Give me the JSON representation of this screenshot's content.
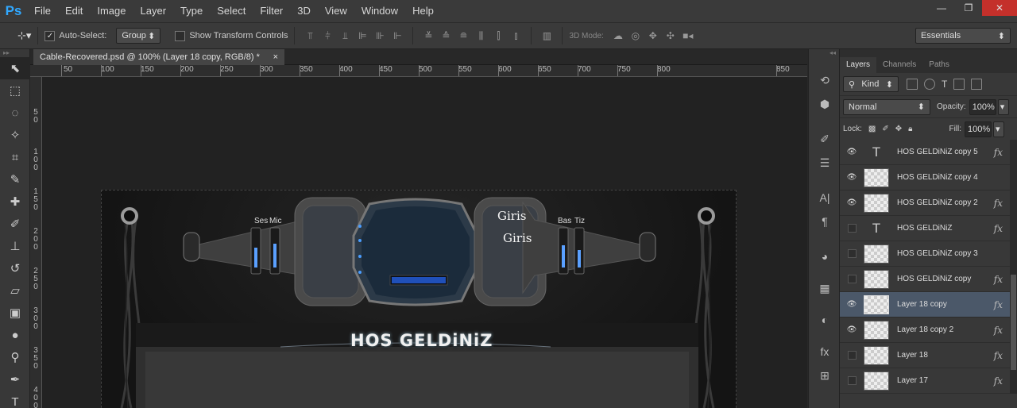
{
  "app": {
    "logo": "Ps"
  },
  "menu": [
    "File",
    "Edit",
    "Image",
    "Layer",
    "Type",
    "Select",
    "Filter",
    "3D",
    "View",
    "Window",
    "Help"
  ],
  "window_controls": {
    "minimize": "—",
    "restore": "❐",
    "close": "✕"
  },
  "options": {
    "auto_select_label": "Auto-Select:",
    "auto_select_value": "Group",
    "transform_label": "Show Transform Controls",
    "mode_3d_label": "3D Mode:",
    "workspace": "Essentials"
  },
  "document": {
    "tab_title": "Cable-Recovered.psd @ 100% (Layer 18 copy, RGB/8) *",
    "close": "×"
  },
  "ruler_top": [
    "50",
    "100",
    "150",
    "200",
    "250",
    "300",
    "350",
    "400",
    "450",
    "500",
    "550",
    "600",
    "650",
    "700",
    "750",
    "800",
    "850"
  ],
  "ruler_left": [
    "5 0",
    "1 0 0",
    "1 5 0",
    "2 0 0",
    "2 5 0",
    "3 0 0",
    "3 5 0",
    "4 0 0"
  ],
  "artwork": {
    "ses": "Ses",
    "mic": "Mic",
    "bas": "Bas",
    "tiz": "Tiz",
    "giris1": "Giris",
    "giris2": "Giris",
    "banner": "HOS GELDiNiZ"
  },
  "panel": {
    "tabs": [
      "Layers",
      "Channels",
      "Paths"
    ],
    "kind": "Kind",
    "blend": "Normal",
    "opacity_label": "Opacity:",
    "opacity": "100%",
    "lock_label": "Lock:",
    "fill_label": "Fill:",
    "fill": "100%"
  },
  "layers": [
    {
      "name": "HOS GELDiNiZ copy 5",
      "visible": true,
      "type": "text",
      "fx": true
    },
    {
      "name": "HOS GELDiNiZ copy 4",
      "visible": true,
      "type": "raster",
      "fx": false
    },
    {
      "name": "HOS GELDiNiZ copy 2",
      "visible": true,
      "type": "raster",
      "fx": true
    },
    {
      "name": "HOS GELDiNiZ",
      "visible": false,
      "type": "text",
      "fx": true
    },
    {
      "name": "HOS GELDiNiZ copy 3",
      "visible": false,
      "type": "raster",
      "fx": false
    },
    {
      "name": "HOS GELDiNiZ copy",
      "visible": false,
      "type": "raster",
      "fx": true
    },
    {
      "name": "Layer 18 copy",
      "visible": true,
      "type": "raster",
      "fx": true,
      "selected": true
    },
    {
      "name": "Layer 18 copy 2",
      "visible": true,
      "type": "raster",
      "fx": true
    },
    {
      "name": "Layer 18",
      "visible": false,
      "type": "raster",
      "fx": true
    },
    {
      "name": "Layer 17",
      "visible": false,
      "type": "raster",
      "fx": true
    }
  ],
  "fx_label": "fx",
  "colors": {
    "accent": "#31a8ff",
    "selected_row": "#4b5869",
    "close_red": "#c4302b"
  }
}
